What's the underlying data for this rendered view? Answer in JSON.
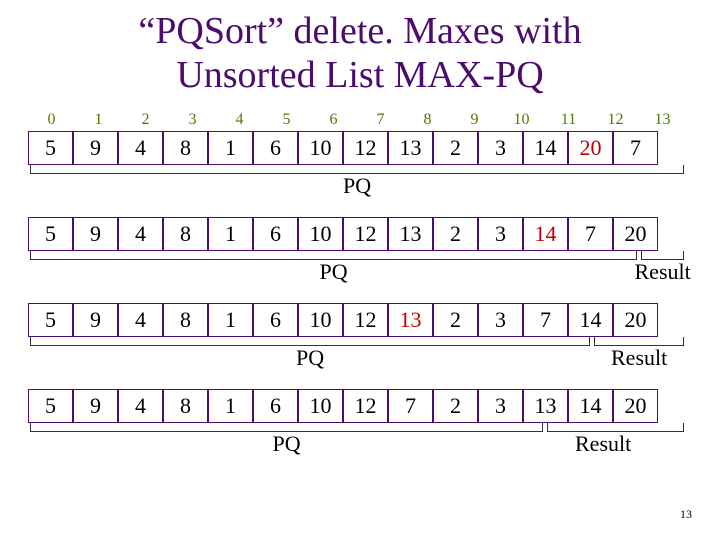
{
  "title_line1": "“PQSort” delete. Maxes with",
  "title_line2": "Unsorted List MAX-PQ",
  "indices": [
    "0",
    "1",
    "2",
    "3",
    "4",
    "5",
    "6",
    "7",
    "8",
    "9",
    "10",
    "11",
    "12",
    "13"
  ],
  "rows": [
    {
      "cells": [
        "5",
        "9",
        "4",
        "8",
        "1",
        "6",
        "10",
        "12",
        "13",
        "2",
        "3",
        "14",
        "20",
        "7"
      ],
      "redIdx": [
        12
      ]
    },
    {
      "cells": [
        "5",
        "9",
        "4",
        "8",
        "1",
        "6",
        "10",
        "12",
        "13",
        "2",
        "3",
        "14",
        "7",
        "20"
      ],
      "redIdx": [
        11
      ]
    },
    {
      "cells": [
        "5",
        "9",
        "4",
        "8",
        "1",
        "6",
        "10",
        "12",
        "13",
        "2",
        "3",
        "7",
        "14",
        "20"
      ],
      "redIdx": [
        8
      ]
    },
    {
      "cells": [
        "5",
        "9",
        "4",
        "8",
        "1",
        "6",
        "10",
        "12",
        "7",
        "2",
        "3",
        "13",
        "14",
        "20"
      ],
      "redIdx": []
    }
  ],
  "labels": {
    "pq": "PQ",
    "result": "Result"
  },
  "brackets": [
    {
      "pqEnd": 14,
      "hasResult": false
    },
    {
      "pqEnd": 13,
      "hasResult": true,
      "resultStart": 13,
      "resultEnd": 14
    },
    {
      "pqEnd": 12,
      "hasResult": true,
      "resultStart": 12,
      "resultEnd": 14
    },
    {
      "pqEnd": 11,
      "hasResult": true,
      "resultStart": 11,
      "resultEnd": 14
    }
  ],
  "pageNum": "13"
}
